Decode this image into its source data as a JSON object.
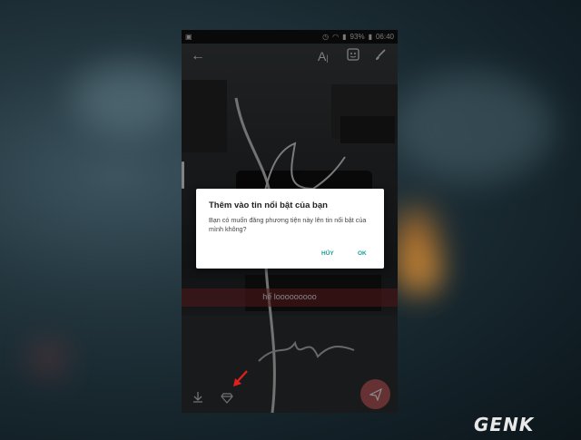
{
  "status_bar": {
    "battery": "93%",
    "time": "06:40"
  },
  "toolbar": {
    "back_icon": "arrow-left-icon",
    "text_icon": "text-tool-icon",
    "sticker_icon": "sticker-icon",
    "draw_icon": "brush-icon"
  },
  "story": {
    "caption": "hế looooooooo"
  },
  "dialog": {
    "title": "Thêm vào tin nổi bật của bạn",
    "message": "Bạn có muốn đăng phương tiện này lên tin nổi bật của mình không?",
    "cancel_label": "HỦY",
    "ok_label": "OK"
  },
  "bottom_bar": {
    "download_icon": "download-icon",
    "highlight_icon": "diamond-icon",
    "send_icon": "send-icon"
  },
  "watermark": "GENK",
  "colors": {
    "accent": "#1a9e9a",
    "fab": "#b95a5e",
    "caption_bar": "#96282d"
  }
}
